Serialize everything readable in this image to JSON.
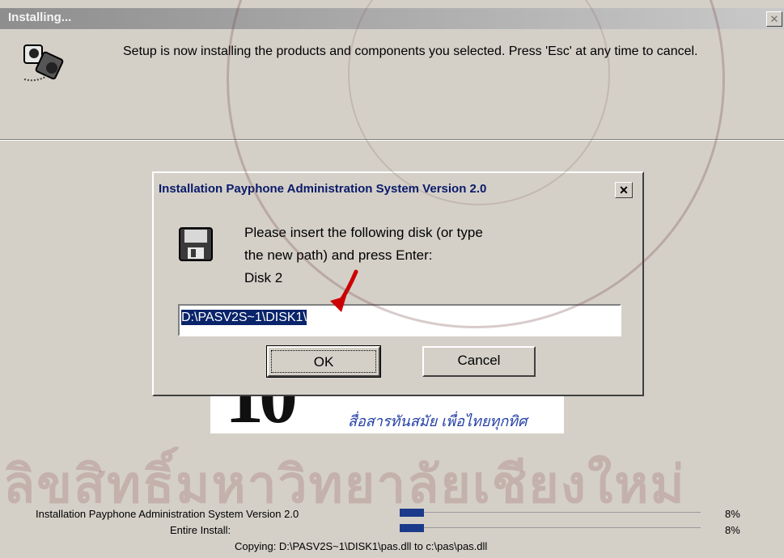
{
  "outer_window": {
    "title": "Installing...",
    "message": "Setup is now installing the products and components you selected.  Press 'Esc' at any time to cancel."
  },
  "dialog": {
    "title": "Installation Payphone Administration System Version 2.0",
    "message_lines": [
      "Please insert the following disk (or type",
      "the new path) and press Enter:",
      "Disk 2"
    ],
    "path_value": "D:\\PASV2S~1\\DISK1\\",
    "ok_label": "OK",
    "cancel_label": "Cancel"
  },
  "banner": {
    "slogan": "สื่อสารทันสมัย เพื่อไทยทุกทิศ"
  },
  "progress": [
    {
      "label": "Installation Payphone Administration System Version 2.0",
      "fraction": 0.08,
      "percent_text": "8%"
    },
    {
      "label": "Entire Install:",
      "fraction": 0.08,
      "percent_text": "8%"
    }
  ],
  "status": {
    "copying": "Copying: D:\\PASV2S~1\\DISK1\\pas.dll to c:\\pas\\pas.dll"
  },
  "watermark": {
    "thai_text": "ลิขสิทธิ์มหาวิทยาลัยเชียงใหม่"
  },
  "colors": {
    "window_bg": "#d4d0c8",
    "selection": "#0a246a",
    "progress_fill": "#1c3a8a",
    "arrow": "#cc0000"
  },
  "icons": [
    "installer-icon",
    "floppy-disk-icon",
    "close-icon",
    "red-arrow-icon"
  ]
}
